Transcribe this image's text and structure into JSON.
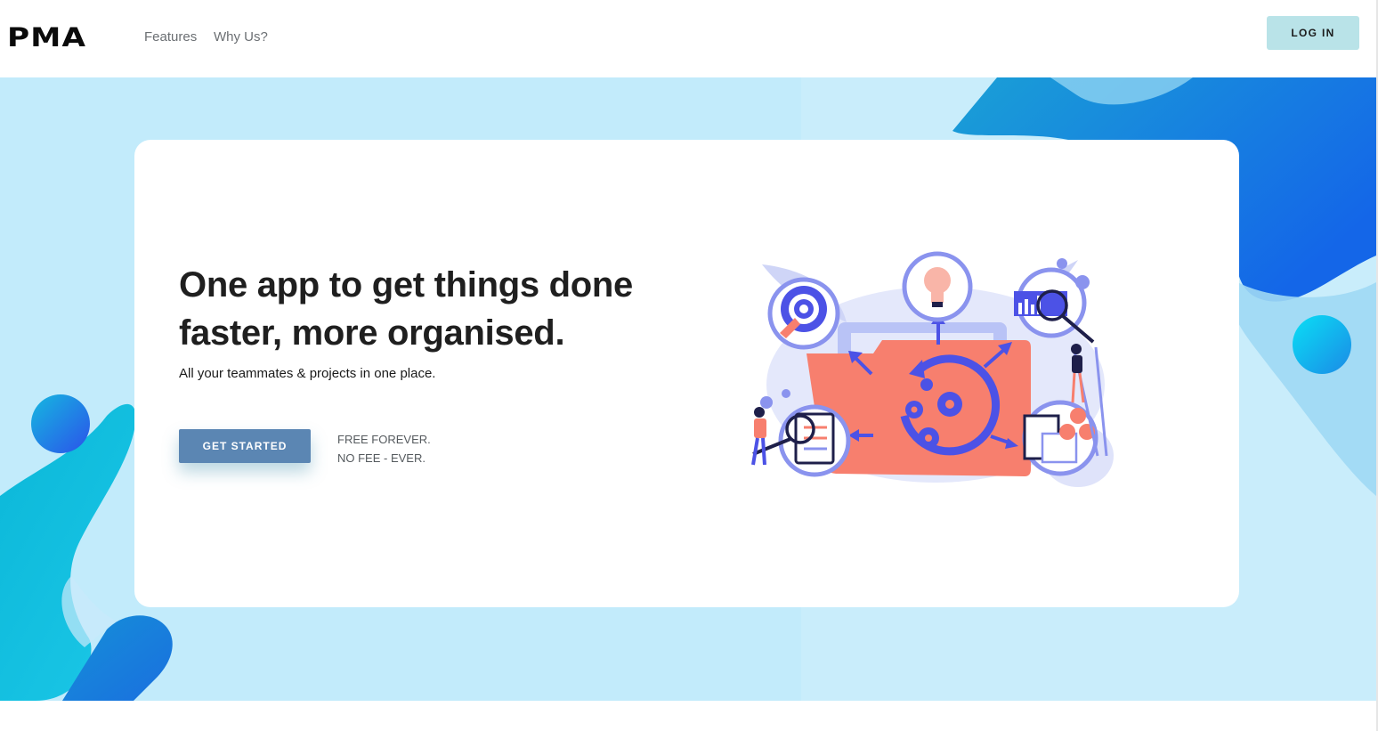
{
  "header": {
    "logo": "PMA",
    "nav": [
      {
        "label": "Features"
      },
      {
        "label": "Why Us?"
      }
    ],
    "login_label": "LOG IN"
  },
  "hero": {
    "headline": "One app to get things done faster, more organised.",
    "subtitle": "All your teammates & projects in one place.",
    "cta_label": "GET STARTED",
    "note_line1": "FREE FOREVER.",
    "note_line2": "NO FEE - EVER."
  },
  "colors": {
    "login_bg": "#b9e3e8",
    "cta_bg": "#5b86b3",
    "hero_bg": "#c9ecfa",
    "accent_blue": "#4c52e6",
    "accent_coral": "#f77f6e"
  },
  "illustration": {
    "icons": [
      "rocket-target-icon",
      "lightbulb-icon",
      "chart-magnifier-icon",
      "folder-gears-icon",
      "clipboard-icon",
      "team-chart-icon"
    ]
  }
}
